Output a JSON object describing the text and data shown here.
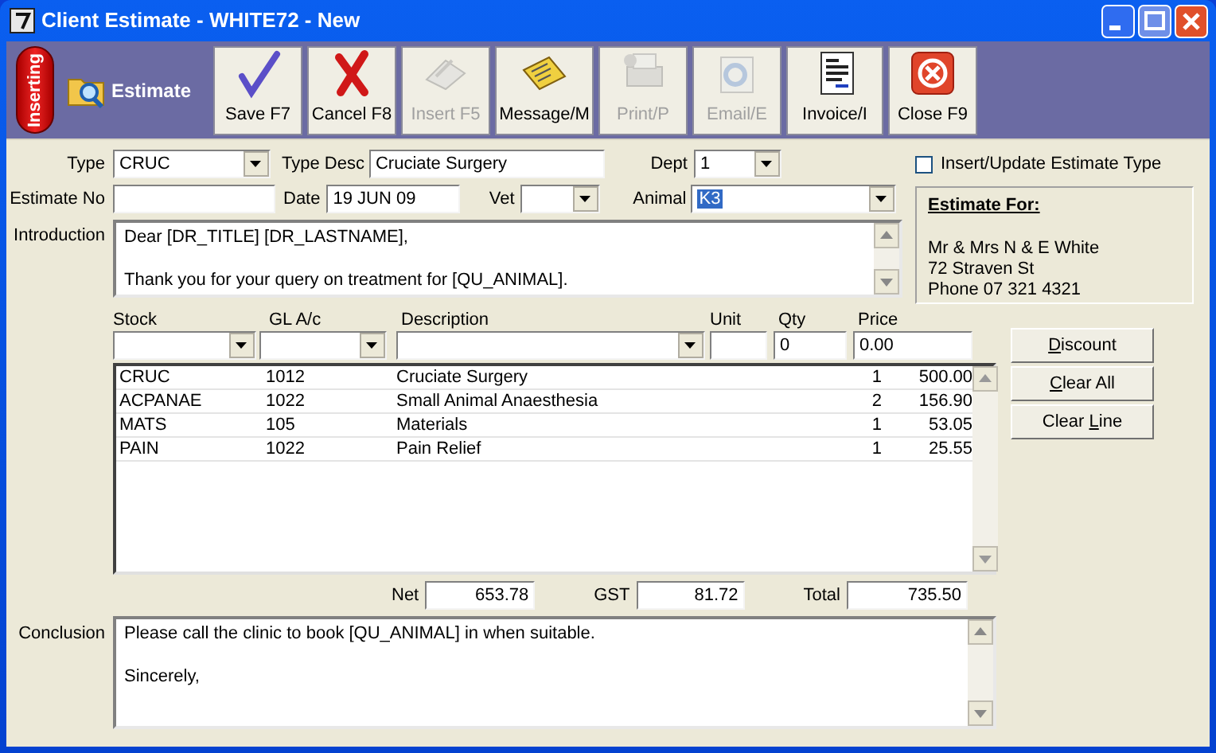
{
  "window": {
    "title": "Client Estimate - WHITE72 - New"
  },
  "toolbar": {
    "mode_badge": "Inserting",
    "section_title": "Estimate",
    "buttons": [
      {
        "label": "Save F7",
        "disabled": false
      },
      {
        "label": "Cancel F8",
        "disabled": false
      },
      {
        "label": "Insert F5",
        "disabled": true
      },
      {
        "label": "Message/M",
        "disabled": false
      },
      {
        "label": "Print/P",
        "disabled": true
      },
      {
        "label": "Email/E",
        "disabled": true
      },
      {
        "label": "Invoice/I",
        "disabled": false
      },
      {
        "label": "Close F9",
        "disabled": false
      }
    ]
  },
  "form": {
    "type": {
      "label": "Type",
      "value": "CRUC"
    },
    "type_desc": {
      "label": "Type Desc",
      "value": "Cruciate Surgery"
    },
    "dept": {
      "label": "Dept",
      "value": "1"
    },
    "insert_update": {
      "label": "Insert/Update Estimate Type",
      "checked": false
    },
    "estimate_no": {
      "label": "Estimate No"
    },
    "date": {
      "label": "Date",
      "value": "19 JUN 09"
    },
    "vet": {
      "label": "Vet"
    },
    "animal": {
      "label": "Animal",
      "value": "K3",
      "value_selected": true
    },
    "introduction": {
      "label": "Introduction",
      "paragraphs": [
        "Dear [DR_TITLE] [DR_LASTNAME],",
        "Thank you for your query on treatment for [QU_ANIMAL]."
      ]
    }
  },
  "estimate_for": {
    "heading": "Estimate For:",
    "lines": [
      "Mr & Mrs N & E White",
      "72 Straven St",
      "Phone 07 321 4321"
    ]
  },
  "line_entry": [
    {
      "label": "Stock",
      "kind": "combo"
    },
    {
      "label": "GL A/c",
      "kind": "combo"
    },
    {
      "label": "Description",
      "kind": "combo"
    },
    {
      "label": "Unit",
      "kind": "field"
    },
    {
      "label": "Qty",
      "kind": "field",
      "value": "0"
    },
    {
      "label": "Price",
      "kind": "field",
      "value": "0.00"
    }
  ],
  "side_buttons": [
    {
      "mnemonic": "D",
      "rest": "iscount"
    },
    {
      "mnemonic": "C",
      "rest": "lear All"
    },
    {
      "before": "Clear ",
      "mnemonic": "L",
      "rest": "ine"
    }
  ],
  "items": [
    {
      "stock": "CRUC",
      "gl": "1012",
      "description": "Cruciate Surgery",
      "qty": "1",
      "price": "500.00"
    },
    {
      "stock": "ACPANAE",
      "gl": "1022",
      "description": "Small Animal Anaesthesia",
      "qty": "2",
      "price": "156.90"
    },
    {
      "stock": "MATS",
      "gl": "105",
      "description": "Materials",
      "qty": "1",
      "price": "53.05"
    },
    {
      "stock": "PAIN",
      "gl": "1022",
      "description": "Pain Relief",
      "qty": "1",
      "price": "25.55"
    }
  ],
  "totals": [
    {
      "label": "Net",
      "value": "653.78"
    },
    {
      "label": "GST",
      "value": "81.72"
    },
    {
      "label": "Total",
      "value": "735.50"
    }
  ],
  "conclusion": {
    "label": "Conclusion",
    "paragraphs": [
      "Please call the clinic to book [QU_ANIMAL] in when suitable.",
      "Sincerely,"
    ]
  }
}
